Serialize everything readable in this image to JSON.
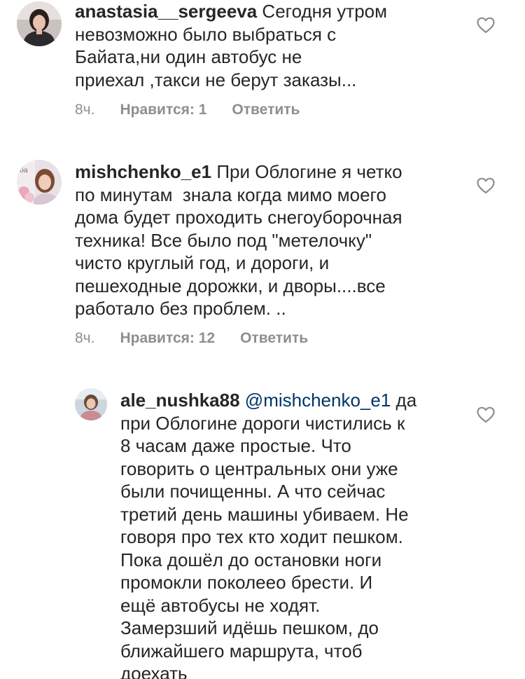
{
  "comments": [
    {
      "username": "anastasia__sergeeva",
      "text": " Сегодня утром\nневозможно было выбраться с\nБайата,ни один автобус не\nприехал ,такси не берут заказы...",
      "time": "8ч.",
      "likes": "Нравится: 1",
      "reply": "Ответить"
    },
    {
      "username": "mishchenko_e1",
      "text": " При Облогине я четко\nпо минутам  знала когда мимо моего\nдома будет проходить снегоуборочная\nтехника! Все было под \"метелочку\"\nчисто круглый год, и дороги, и\nпешеходные дорожки, и дворы....все\nработало без проблем. ..",
      "time": "8ч.",
      "likes": "Нравится: 12",
      "reply": "Ответить"
    },
    {
      "username": "ale_nushka88",
      "mention": "@mishchenko_e1",
      "text_before_mention": " ",
      "text": " да\nпри Облогине дороги чистились к\n8 часам даже простые. Что\nговорить о центральных они уже\nбыли почищенны. А что сейчас\nтретий день машины убиваем. Не\nговоря про тех кто ходит пешком.\nПока дошёл до остановки ноги\nпромокли поколеео брести. И\nещё автобусы не ходят.\nЗамерзший идёшь пешком, до\nближайшего маршрута, чтоб\nдоехать"
    }
  ],
  "icons": {
    "like": "heart-outline-icon"
  },
  "colors": {
    "text": "#262626",
    "meta": "#8e8e8e",
    "mention": "#003569"
  }
}
